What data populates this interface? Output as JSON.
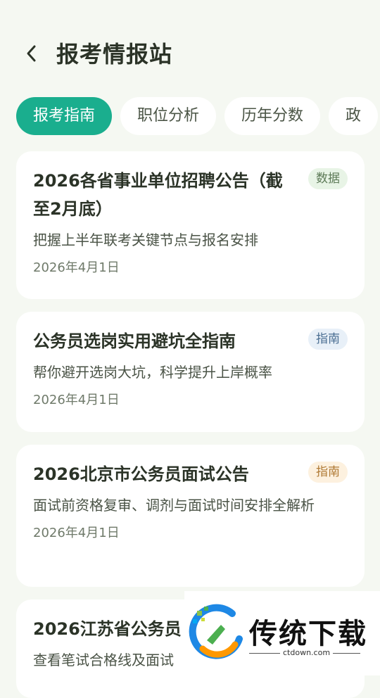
{
  "header": {
    "title": "报考情报站"
  },
  "tabs": [
    {
      "label": "报考指南",
      "active": true
    },
    {
      "label": "职位分析",
      "active": false
    },
    {
      "label": "历年分数",
      "active": false
    },
    {
      "label": "政",
      "active": false
    }
  ],
  "cards": [
    {
      "title": "2026各省事业单位招聘公告（截至2月底）",
      "badge": "数据",
      "desc": "把握上半年联考关键节点与报名安排",
      "date": "2026年4月1日"
    },
    {
      "title": "公务员选岗实用避坑全指南",
      "badge": "指南",
      "desc": "帮你避开选岗大坑，科学提升上岸概率",
      "date": "2026年4月1日"
    },
    {
      "title": "2026北京市公务员面试公告",
      "badge": "指南",
      "desc": "面试前资格复审、调剂与面试时间安排全解析",
      "date": "2026年4月1日"
    },
    {
      "title": "2026江苏省公务员",
      "desc": "查看笔试合格线及面试"
    }
  ],
  "watermark": {
    "brand": "传统下载",
    "domain": "ctdown.com"
  },
  "colors": {
    "accent": "#1aae8e",
    "background": "#f5f8f2"
  }
}
